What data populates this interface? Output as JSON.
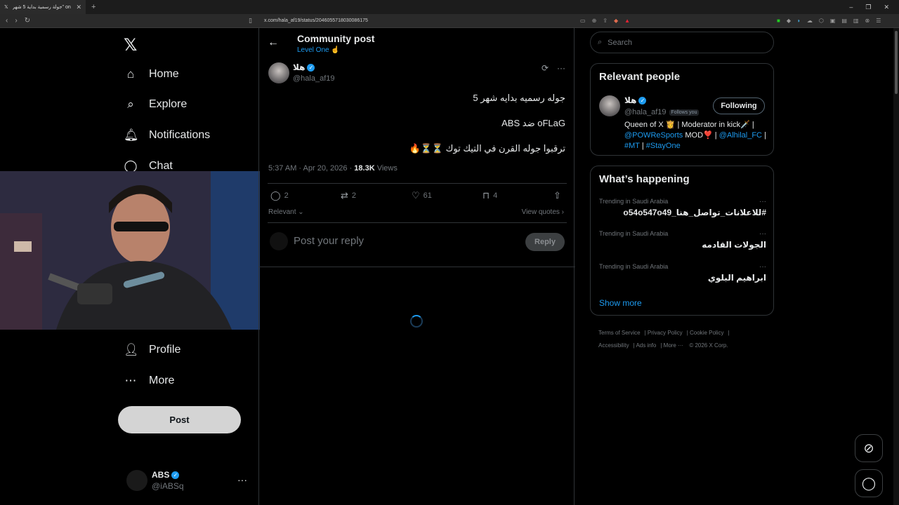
{
  "browser": {
    "tab_title": "جولة رسمية بداية 5 شهر\" on X هلا",
    "url": "x.com/hala_af19/status/2046055718030086175"
  },
  "nav": {
    "logo": "𝕏",
    "items": [
      {
        "label": "Home"
      },
      {
        "label": "Explore"
      },
      {
        "label": "Notifications"
      },
      {
        "label": "Chat"
      },
      {
        "label": "Profile"
      },
      {
        "label": "More"
      }
    ],
    "post_button": "Post",
    "account": {
      "name": "ABS",
      "handle": "@iABSq"
    }
  },
  "header": {
    "title": "Community post",
    "community": "Level One ☝️"
  },
  "post": {
    "author_name": "هلا",
    "author_handle": "@hala_af19",
    "lines": [
      "جوله رسميه بدايه شهر 5",
      "oFLaG ضد ABS",
      "ترقبوا جوله القرن في التيك توك ⏳⏳🔥"
    ],
    "time": "5:37 AM · Apr 20, 2026 · ",
    "views_count": "18.3K",
    "views_label": " Views",
    "replies": "2",
    "reposts": "2",
    "likes": "61",
    "bookmarks": "4",
    "sort_label": "Relevant",
    "view_quotes": "View quotes"
  },
  "reply": {
    "placeholder": "Post your reply",
    "button": "Reply"
  },
  "search": {
    "placeholder": "Search"
  },
  "relevant_people": {
    "title": "Relevant people",
    "name": "هلا",
    "handle": "@hala_af19",
    "follows_you": "Follows you",
    "button": "Following",
    "bio_text1": "Queen of X 👸 | Moderator in kick🗡️ |",
    "bio_link1": "@POWReSports",
    "bio_text2": " MOD❣️ | ",
    "bio_link2": "@Alhilal_FC",
    "bio_text3": " |",
    "bio_link3": "#MT",
    "bio_text4": " | ",
    "bio_link4": "#StayOne"
  },
  "happening": {
    "title": "What’s happening",
    "trends": [
      {
        "category": "Trending in Saudi Arabia",
        "name": "#للاعلانات_تواصل_هنا_o54o547o49"
      },
      {
        "category": "Trending in Saudi Arabia",
        "name": "الجولات القادمه"
      },
      {
        "category": "Trending in Saudi Arabia",
        "name": "ابراهيم البلوي"
      }
    ],
    "show_more": "Show more"
  },
  "footer": {
    "links": [
      "Terms of Service",
      "Privacy Policy",
      "Cookie Policy",
      "Accessibility",
      "Ads info",
      "More ···",
      "© 2026 X Corp."
    ]
  },
  "colors": {
    "accent": "#1d9bf0",
    "background": "#000000",
    "muted": "#71767b"
  }
}
